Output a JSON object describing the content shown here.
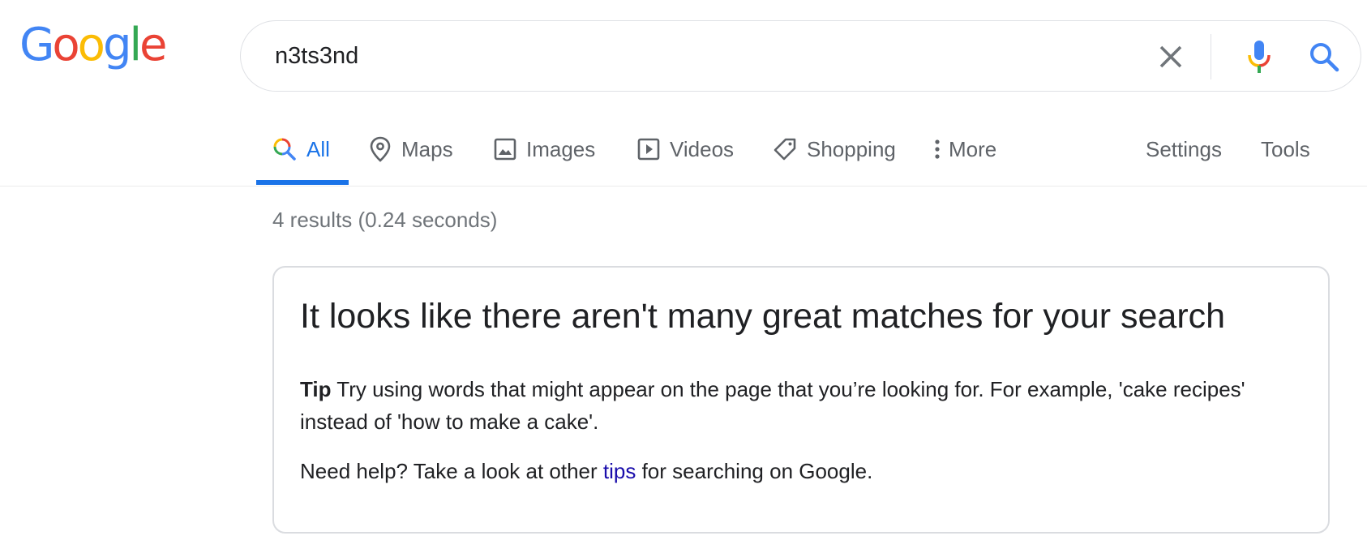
{
  "logo": {
    "letters": [
      "G",
      "o",
      "o",
      "g",
      "l",
      "e"
    ],
    "colors": [
      "#4285F4",
      "#EA4335",
      "#FBBC05",
      "#4285F4",
      "#34A853",
      "#EA4335"
    ]
  },
  "search": {
    "value": "n3ts3nd",
    "clear_icon": "close-icon",
    "mic_icon": "microphone-icon",
    "search_icon": "search-icon"
  },
  "tabs": [
    {
      "label": "All",
      "icon": "search-multicolor-icon",
      "active": true
    },
    {
      "label": "Maps",
      "icon": "map-pin-icon",
      "active": false
    },
    {
      "label": "Images",
      "icon": "image-icon",
      "active": false
    },
    {
      "label": "Videos",
      "icon": "video-icon",
      "active": false
    },
    {
      "label": "Shopping",
      "icon": "tag-icon",
      "active": false
    },
    {
      "label": "More",
      "icon": "more-vertical-icon",
      "active": false
    }
  ],
  "tools": {
    "settings_label": "Settings",
    "tools_label": "Tools"
  },
  "result_stats": "4 results (0.24 seconds)",
  "card": {
    "title": "It looks like there aren't many great matches for your search",
    "tip_label": "Tip",
    "tip_text": " Try using words that might appear on the page that you’re looking for. For example, 'cake recipes' instead of 'how to make a cake'.",
    "help_prefix": "Need help? Take a look at other ",
    "help_link": "tips",
    "help_suffix": " for searching on Google."
  },
  "colors": {
    "accent": "#1a73e8",
    "link": "#1a0dab",
    "muted": "#5f6368"
  }
}
